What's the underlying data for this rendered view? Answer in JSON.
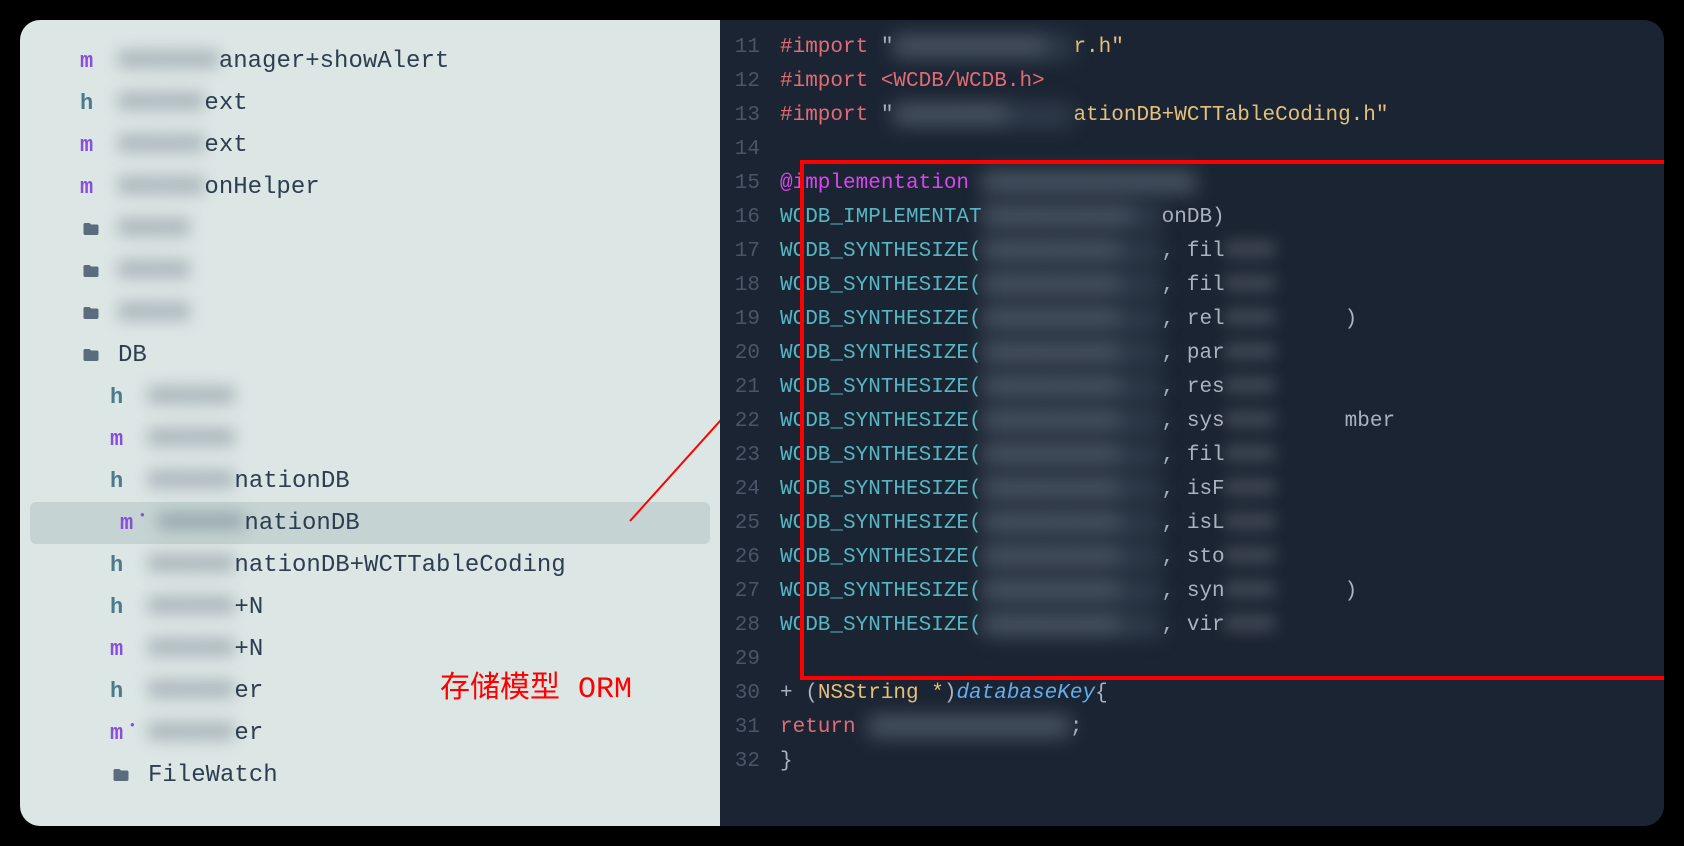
{
  "sidebar": {
    "files": [
      {
        "icon": "m",
        "prefix_blur": "XXXXXXX",
        "name": "anager+showAlert",
        "indent": 1
      },
      {
        "icon": "h",
        "prefix_blur": "XXXXXX",
        "name": "ext",
        "indent": 1
      },
      {
        "icon": "m",
        "prefix_blur": "XXXXXX",
        "name": "ext",
        "indent": 1
      },
      {
        "icon": "m",
        "prefix_blur": "XXXXXX",
        "name": "onHelper",
        "indent": 1
      },
      {
        "icon": "folder",
        "prefix_blur": "XXXXX",
        "name": "",
        "indent": 1
      },
      {
        "icon": "folder",
        "prefix_blur": "XXXXX",
        "name": "",
        "indent": 1
      },
      {
        "icon": "folder",
        "prefix_blur": "XXXXX",
        "name": "",
        "indent": 1
      },
      {
        "icon": "folder",
        "prefix_blur": "",
        "name": "DB",
        "indent": 1
      },
      {
        "icon": "h",
        "prefix_blur": "XXXXXX",
        "name": "",
        "indent": 2
      },
      {
        "icon": "m",
        "prefix_blur": "XXXXXX",
        "name": "",
        "indent": 2
      },
      {
        "icon": "h",
        "prefix_blur": "XXXXXX",
        "name": "nationDB",
        "indent": 2
      },
      {
        "icon": "m*",
        "prefix_blur": "XXXXXX",
        "name": "nationDB",
        "indent": 2,
        "selected": true
      },
      {
        "icon": "h",
        "prefix_blur": "XXXXXX",
        "name": "nationDB+WCTTableCoding",
        "indent": 2
      },
      {
        "icon": "h",
        "prefix_blur": "XXXXXX",
        "name": "+N",
        "indent": 2
      },
      {
        "icon": "m",
        "prefix_blur": "XXXXXX",
        "name": "+N",
        "indent": 2
      },
      {
        "icon": "h",
        "prefix_blur": "XXXXXX",
        "name": "er",
        "indent": 2
      },
      {
        "icon": "m*",
        "prefix_blur": "XXXXXX",
        "name": "er",
        "indent": 2
      },
      {
        "icon": "folder",
        "prefix_blur": "",
        "name": "FileWatch",
        "indent": 2
      }
    ]
  },
  "editor": {
    "lines": [
      {
        "num": "11",
        "tokens": [
          {
            "cls": "kw-preprocessor",
            "t": "#import"
          },
          {
            "cls": "kw-punct",
            "t": " \""
          },
          {
            "cls": "code-blur",
            "t": "XXXXXXXXXXXX"
          },
          {
            "cls": "kw-string",
            "t": "r.h\""
          }
        ]
      },
      {
        "num": "12",
        "tokens": [
          {
            "cls": "kw-preprocessor",
            "t": "#import"
          },
          {
            "cls": "kw-preprocessor",
            "t": " <WCDB/WCDB.h>"
          }
        ]
      },
      {
        "num": "13",
        "tokens": [
          {
            "cls": "kw-preprocessor",
            "t": "#import"
          },
          {
            "cls": "kw-punct",
            "t": " \""
          },
          {
            "cls": "code-blur",
            "t": "XXXXXXXXX"
          },
          {
            "cls": "kw-string",
            "t": "ationDB+WCTTableCoding.h\""
          }
        ]
      },
      {
        "num": "14",
        "tokens": []
      },
      {
        "num": "15",
        "tokens": [
          {
            "cls": "kw-at",
            "t": "@implementation"
          },
          {
            "cls": "",
            "t": " "
          },
          {
            "cls": "code-blur",
            "t": "XXXXXXXXXXXXXXXXX"
          }
        ]
      },
      {
        "num": "16",
        "tokens": [
          {
            "cls": "kw-macro",
            "t": "WCDB_IMPLEMENTAT"
          },
          {
            "cls": "code-blur",
            "t": "XXXXXXXXXXXX"
          },
          {
            "cls": "kw-punct",
            "t": "onDB)"
          }
        ]
      },
      {
        "num": "17",
        "tokens": [
          {
            "cls": "kw-macro",
            "t": "WCDB_SYNTHESIZE("
          },
          {
            "cls": "code-blur",
            "t": "XXXXXXXXXXX"
          },
          {
            "cls": "kw-punct",
            "t": ", fil"
          },
          {
            "cls": "code-blur-sm",
            "t": "XXXX"
          }
        ]
      },
      {
        "num": "18",
        "tokens": [
          {
            "cls": "kw-macro",
            "t": "WCDB_SYNTHESIZE("
          },
          {
            "cls": "code-blur",
            "t": "XXXXXXXXXXX"
          },
          {
            "cls": "kw-punct",
            "t": ", fil"
          },
          {
            "cls": "code-blur-sm",
            "t": "XXXX"
          }
        ]
      },
      {
        "num": "19",
        "tokens": [
          {
            "cls": "kw-macro",
            "t": "WCDB_SYNTHESIZE("
          },
          {
            "cls": "code-blur",
            "t": "XXXXXXXXXXX"
          },
          {
            "cls": "kw-punct",
            "t": ", rel"
          },
          {
            "cls": "code-blur-sm",
            "t": "XXXX"
          },
          {
            "cls": "kw-punct",
            "t": ")"
          }
        ]
      },
      {
        "num": "20",
        "tokens": [
          {
            "cls": "kw-macro",
            "t": "WCDB_SYNTHESIZE("
          },
          {
            "cls": "code-blur",
            "t": "XXXXXXXXXXX"
          },
          {
            "cls": "kw-punct",
            "t": ", par"
          },
          {
            "cls": "code-blur-sm",
            "t": "XXXX"
          }
        ]
      },
      {
        "num": "21",
        "tokens": [
          {
            "cls": "kw-macro",
            "t": "WCDB_SYNTHESIZE("
          },
          {
            "cls": "code-blur",
            "t": "XXXXXXXXXXX"
          },
          {
            "cls": "kw-punct",
            "t": ", res"
          },
          {
            "cls": "code-blur-sm",
            "t": "XXXX"
          }
        ]
      },
      {
        "num": "22",
        "tokens": [
          {
            "cls": "kw-macro",
            "t": "WCDB_SYNTHESIZE("
          },
          {
            "cls": "code-blur",
            "t": "XXXXXXXXXXX"
          },
          {
            "cls": "kw-punct",
            "t": ", sys"
          },
          {
            "cls": "code-blur-sm",
            "t": "XXXX"
          },
          {
            "cls": "kw-punct",
            "t": "mber"
          }
        ]
      },
      {
        "num": "23",
        "tokens": [
          {
            "cls": "kw-macro",
            "t": "WCDB_SYNTHESIZE("
          },
          {
            "cls": "code-blur",
            "t": "XXXXXXXXXXX"
          },
          {
            "cls": "kw-punct",
            "t": ", fil"
          },
          {
            "cls": "code-blur-sm",
            "t": "XXXX"
          }
        ]
      },
      {
        "num": "24",
        "tokens": [
          {
            "cls": "kw-macro",
            "t": "WCDB_SYNTHESIZE("
          },
          {
            "cls": "code-blur",
            "t": "XXXXXXXXXXX"
          },
          {
            "cls": "kw-punct",
            "t": ", isF"
          },
          {
            "cls": "code-blur-sm",
            "t": "XXXX"
          }
        ]
      },
      {
        "num": "25",
        "tokens": [
          {
            "cls": "kw-macro",
            "t": "WCDB_SYNTHESIZE("
          },
          {
            "cls": "code-blur",
            "t": "XXXXXXXXXXX"
          },
          {
            "cls": "kw-punct",
            "t": ", isL"
          },
          {
            "cls": "code-blur-sm",
            "t": "XXXX"
          }
        ]
      },
      {
        "num": "26",
        "tokens": [
          {
            "cls": "kw-macro",
            "t": "WCDB_SYNTHESIZE("
          },
          {
            "cls": "code-blur",
            "t": "XXXXXXXXXXX"
          },
          {
            "cls": "kw-punct",
            "t": ", sto"
          },
          {
            "cls": "code-blur-sm",
            "t": "XXXX"
          }
        ]
      },
      {
        "num": "27",
        "tokens": [
          {
            "cls": "kw-macro",
            "t": "WCDB_SYNTHESIZE("
          },
          {
            "cls": "code-blur",
            "t": "XXXXXXXXXXX"
          },
          {
            "cls": "kw-punct",
            "t": ", syn"
          },
          {
            "cls": "code-blur-sm",
            "t": "XXXX"
          },
          {
            "cls": "kw-punct",
            "t": ")"
          }
        ]
      },
      {
        "num": "28",
        "tokens": [
          {
            "cls": "kw-macro",
            "t": "WCDB_SYNTHESIZE("
          },
          {
            "cls": "code-blur",
            "t": "XXXXXXXXXXX"
          },
          {
            "cls": "kw-punct",
            "t": ", vir"
          },
          {
            "cls": "code-blur-sm",
            "t": "XXXX"
          }
        ]
      },
      {
        "num": "29",
        "tokens": []
      },
      {
        "num": "30",
        "tokens": [
          {
            "cls": "kw-plus",
            "t": "+ ("
          },
          {
            "cls": "kw-type",
            "t": "NSString *"
          },
          {
            "cls": "kw-plus",
            "t": ")"
          },
          {
            "cls": "kw-method",
            "t": "databaseKey"
          },
          {
            "cls": "kw-punct",
            "t": "{"
          }
        ]
      },
      {
        "num": "31",
        "tokens": [
          {
            "cls": "",
            "t": "    "
          },
          {
            "cls": "kw-return",
            "t": "return"
          },
          {
            "cls": "",
            "t": " "
          },
          {
            "cls": "code-blur",
            "t": "XXXXXXXXXXXXXXXX"
          },
          {
            "cls": "kw-punct",
            "t": ";"
          }
        ]
      },
      {
        "num": "32",
        "tokens": [
          {
            "cls": "kw-punct",
            "t": "}"
          }
        ]
      }
    ]
  },
  "annotation": {
    "label": "存储模型 ORM"
  }
}
